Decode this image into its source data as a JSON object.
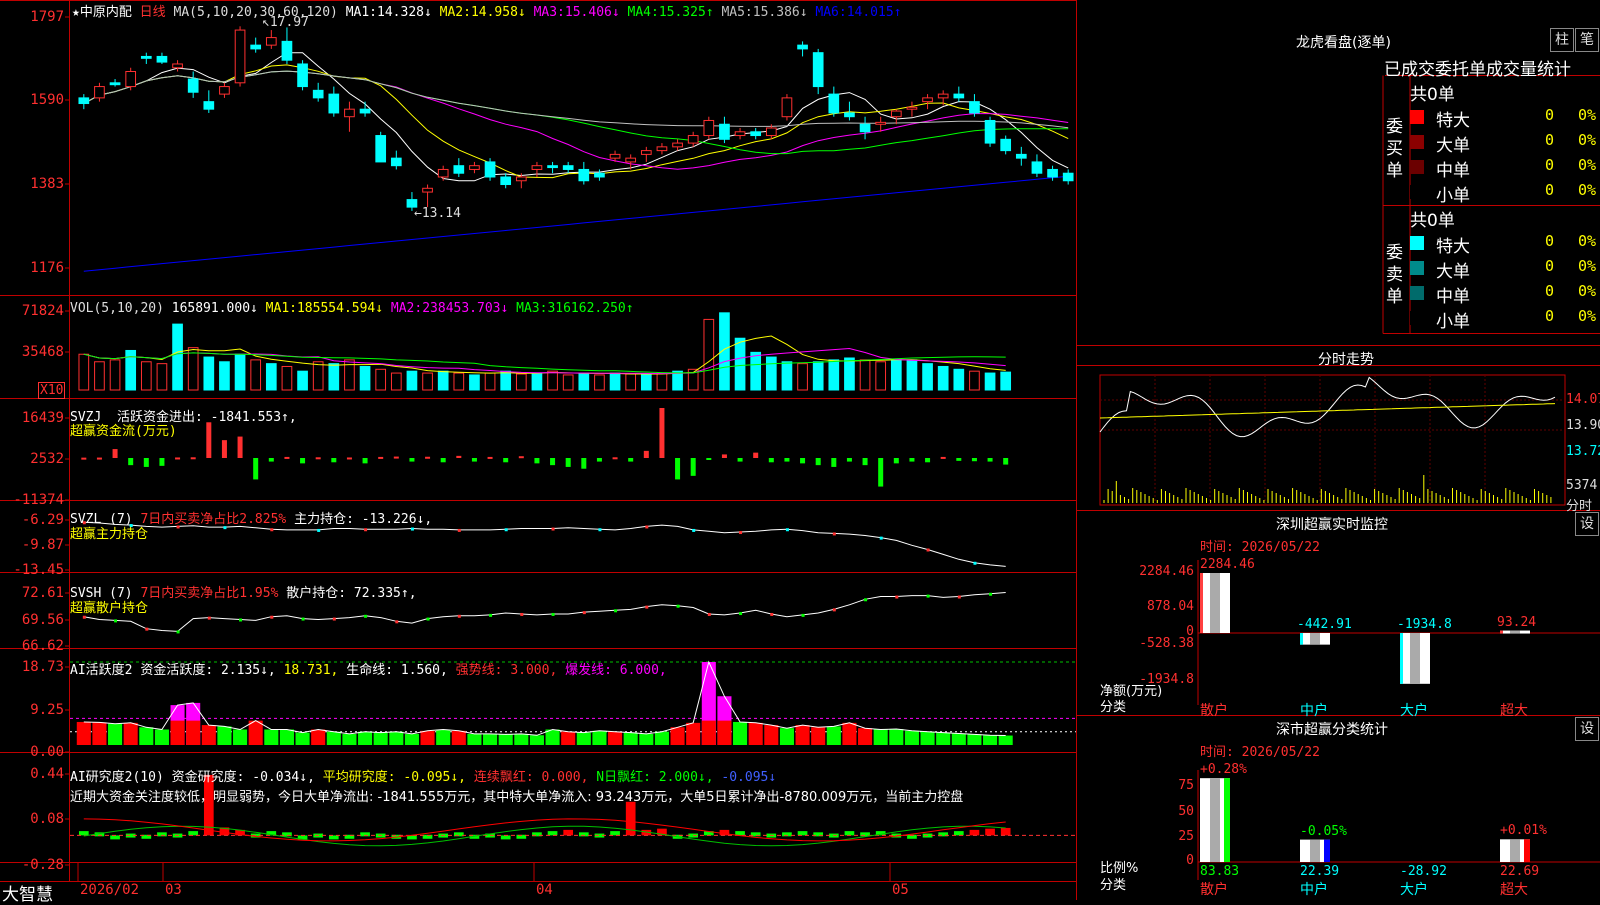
{
  "app": {
    "name": "大智慧",
    "star_title": "★中原内配",
    "period": "日线"
  },
  "main_legend": {
    "ma_label": "MA(5,10,20,30,60,120)",
    "items": [
      {
        "label": "MA1:",
        "value": "14.328↓",
        "color": "#ffffff"
      },
      {
        "label": "MA2:",
        "value": "14.958↓",
        "color": "#ffff00"
      },
      {
        "label": "MA3:",
        "value": "15.406↓",
        "color": "#ff00ff"
      },
      {
        "label": "MA4:",
        "value": "15.325↑",
        "color": "#00ff00"
      },
      {
        "label": "MA5:",
        "value": "15.386↓",
        "color": "#c0c0c0"
      },
      {
        "label": "MA6:",
        "value": "14.015↑",
        "color": "#0000ff"
      }
    ],
    "high_note": "17.97",
    "low_note": "13.14"
  },
  "vol_legend": {
    "label": "VOL(5,10,20)",
    "value": "165891.000↓",
    "items": [
      {
        "label": "MA1:",
        "value": "185554.594↓",
        "color": "#ffff00"
      },
      {
        "label": "MA2:",
        "value": "238453.703↓",
        "color": "#ff00ff"
      },
      {
        "label": "MA3:",
        "value": "316162.250↑",
        "color": "#00ff00"
      }
    ],
    "unit": "X10"
  },
  "svzj_legend": {
    "name": "SVZJ",
    "text": "活跃资金进出: -1841.553↑,",
    "sub": "超赢资金流(万元)"
  },
  "svzl_legend": {
    "name": "SVZL (7)",
    "text1": "7日内买卖净占比2.825%",
    "text2": "主力持仓: -13.226↓,",
    "sub": "超赢主力持仓"
  },
  "svsh_legend": {
    "name": "SVSH (7)",
    "text1": "7日内买卖净占比1.95%",
    "text2": "散户持仓: 72.335↑,",
    "sub": "超赢散户持仓"
  },
  "ai_legend": {
    "name": "AI活跃度2",
    "a": "资金活跃度: 2.135↓,",
    "b": "18.731,",
    "c": "生命线: 1.560,",
    "d": "强势线: 3.000,",
    "e": "爆发线: 6.000,"
  },
  "ai2_legend": {
    "name": "AI研究度2(10)",
    "a": "资金研究度: -0.034↓,",
    "b": "平均研究度: -0.095↓,",
    "c": "连续飘红: 0.000,",
    "d": "N日飘红: 2.000↓,",
    "e": "-0.095↓"
  },
  "commentary": "近期大资金关注度较低，明显弱势，今日大单净流出: -1841.555万元，其中特大单净流入: 93.243万元，大单5日累计净出-8780.009万元，当前主力控盘",
  "y_axes": {
    "main": [
      "1797",
      "1590",
      "1383",
      "1176"
    ],
    "vol": [
      "71824",
      "35468"
    ],
    "svzj": [
      "16439",
      "2532",
      "-11374"
    ],
    "svzl": [
      "-6.29",
      "-9.87",
      "-13.45"
    ],
    "svsh": [
      "72.61",
      "69.56",
      "66.62"
    ],
    "ai": [
      "18.73",
      "9.25",
      "0.00"
    ],
    "ai2": [
      "0.44",
      "0.08",
      "-0.28"
    ]
  },
  "x_axis": [
    "2026/02",
    "03",
    "04",
    "05"
  ],
  "right": {
    "longhu_title": "龙虎看盘(逐单)",
    "btn_bar": "柱",
    "btn_pen": "笔",
    "tabs_label": "已成交委托单成交量统计",
    "buy_side": "委买单",
    "sell_side": "委卖单",
    "buy_total": "共0单",
    "sell_total": "共0单",
    "buy_rows": [
      {
        "label": "特大",
        "count": "0",
        "pct": "0%",
        "color": "#ff0000"
      },
      {
        "label": "大单",
        "count": "0",
        "pct": "0%",
        "color": "#8b0000"
      },
      {
        "label": "中单",
        "count": "0",
        "pct": "0%",
        "color": "#6b0000"
      },
      {
        "label": "小单",
        "count": "0",
        "pct": "0%",
        "color": "#000000"
      }
    ],
    "sell_rows": [
      {
        "label": "特大",
        "count": "0",
        "pct": "0%",
        "color": "#00ffff"
      },
      {
        "label": "大单",
        "count": "0",
        "pct": "0%",
        "color": "#008b8b"
      },
      {
        "label": "中单",
        "count": "0",
        "pct": "0%",
        "color": "#006b6b"
      },
      {
        "label": "小单",
        "count": "0",
        "pct": "0%",
        "color": "#000000"
      }
    ],
    "intraday_title": "分时走势",
    "intraday_ticks": [
      "14.07",
      "13.90",
      "13.72",
      "5374",
      "分时"
    ],
    "sz_monitor_title": "深圳超赢实时监控",
    "sz_time": "时间: 2026/05/22",
    "sz_yticks": [
      "2284.46",
      "878.04",
      "0",
      "-528.38",
      "-1934.8"
    ],
    "sz_bars": [
      {
        "cat": "散户",
        "value": 2284.46,
        "label": "2284.46",
        "color": "#ff4040"
      },
      {
        "cat": "中户",
        "value": -442.91,
        "label": "-442.91",
        "color": "#00ffff"
      },
      {
        "cat": "大户",
        "value": -1934.8,
        "label": "-1934.8",
        "color": "#00ffff"
      },
      {
        "cat": "超大",
        "value": 93.24,
        "label": "93.24",
        "color": "#ff4040"
      }
    ],
    "sz_ylabel1": "净额(万元)",
    "sz_ylabel2": "分类",
    "cls_title": "深市超赢分类统计",
    "cls_time": "时间: 2026/05/22",
    "cls_yticks": [
      "75",
      "50",
      "25",
      "0"
    ],
    "cls_bars": [
      {
        "cat": "散户",
        "value": 83.83,
        "pct": "+0.28%",
        "label": "83.83",
        "color": "#00ff00"
      },
      {
        "cat": "中户",
        "value": 22.39,
        "pct": "-0.05%",
        "label": "22.39",
        "color": "#0000ff"
      },
      {
        "cat": "大户",
        "value": -28.92,
        "pct": "",
        "label": "-28.92",
        "color": "#00ffff"
      },
      {
        "cat": "超大",
        "value": 22.69,
        "pct": "+0.01%",
        "label": "22.69",
        "color": "#ff0000"
      }
    ],
    "cls_ylabel1": "比例%",
    "cls_ylabel2": "分类",
    "set_label": "设"
  },
  "chart_data": {
    "type": "candlestick",
    "note": "price values in 0.01 yuan (axis shows 1797 = 17.97)",
    "ylim": [
      1100,
      1830
    ],
    "candles": [
      [
        1610,
        1620,
        1580,
        1595
      ],
      [
        1610,
        1650,
        1600,
        1640
      ],
      [
        1650,
        1660,
        1640,
        1645
      ],
      [
        1640,
        1690,
        1630,
        1680
      ],
      [
        1720,
        1730,
        1700,
        1715
      ],
      [
        1720,
        1730,
        1700,
        1705
      ],
      [
        1690,
        1710,
        1680,
        1700
      ],
      [
        1660,
        1680,
        1610,
        1625
      ],
      [
        1600,
        1630,
        1570,
        1580
      ],
      [
        1620,
        1650,
        1610,
        1640
      ],
      [
        1650,
        1800,
        1640,
        1790
      ],
      [
        1750,
        1770,
        1730,
        1740
      ],
      [
        1750,
        1790,
        1740,
        1770
      ],
      [
        1760,
        1797,
        1700,
        1710
      ],
      [
        1700,
        1710,
        1630,
        1640
      ],
      [
        1630,
        1650,
        1600,
        1610
      ],
      [
        1620,
        1640,
        1560,
        1570
      ],
      [
        1560,
        1600,
        1520,
        1580
      ],
      [
        1580,
        1600,
        1560,
        1570
      ],
      [
        1510,
        1520,
        1440,
        1440
      ],
      [
        1450,
        1470,
        1420,
        1430
      ],
      [
        1340,
        1360,
        1310,
        1320
      ],
      [
        1360,
        1380,
        1320,
        1370
      ],
      [
        1400,
        1430,
        1390,
        1420
      ],
      [
        1430,
        1450,
        1400,
        1410
      ],
      [
        1420,
        1440,
        1410,
        1430
      ],
      [
        1440,
        1450,
        1390,
        1400
      ],
      [
        1400,
        1410,
        1370,
        1380
      ],
      [
        1390,
        1410,
        1370,
        1400
      ],
      [
        1420,
        1440,
        1400,
        1430
      ],
      [
        1430,
        1440,
        1410,
        1425
      ],
      [
        1430,
        1440,
        1410,
        1420
      ],
      [
        1420,
        1440,
        1380,
        1390
      ],
      [
        1410,
        1420,
        1390,
        1400
      ],
      [
        1450,
        1470,
        1440,
        1460
      ],
      [
        1440,
        1460,
        1420,
        1450
      ],
      [
        1460,
        1480,
        1440,
        1470
      ],
      [
        1470,
        1490,
        1460,
        1480
      ],
      [
        1480,
        1500,
        1470,
        1490
      ],
      [
        1490,
        1520,
        1480,
        1510
      ],
      [
        1510,
        1560,
        1500,
        1550
      ],
      [
        1540,
        1560,
        1490,
        1500
      ],
      [
        1510,
        1530,
        1500,
        1520
      ],
      [
        1520,
        1530,
        1500,
        1510
      ],
      [
        1510,
        1540,
        1500,
        1530
      ],
      [
        1560,
        1620,
        1550,
        1610
      ],
      [
        1750,
        1760,
        1720,
        1740
      ],
      [
        1730,
        1740,
        1620,
        1640
      ],
      [
        1620,
        1640,
        1560,
        1570
      ],
      [
        1570,
        1600,
        1550,
        1560
      ],
      [
        1540,
        1560,
        1500,
        1520
      ],
      [
        1540,
        1560,
        1520,
        1545
      ],
      [
        1560,
        1580,
        1540,
        1575
      ],
      [
        1580,
        1600,
        1560,
        1585
      ],
      [
        1600,
        1620,
        1580,
        1610
      ],
      [
        1610,
        1630,
        1590,
        1620
      ],
      [
        1620,
        1640,
        1600,
        1610
      ],
      [
        1600,
        1620,
        1560,
        1570
      ],
      [
        1550,
        1560,
        1480,
        1490
      ],
      [
        1500,
        1510,
        1460,
        1470
      ],
      [
        1460,
        1480,
        1430,
        1450
      ],
      [
        1440,
        1460,
        1400,
        1410
      ],
      [
        1420,
        1430,
        1390,
        1400
      ],
      [
        1410,
        1420,
        1380,
        1390
      ]
    ],
    "volume": [
      [
        38000,
        1
      ],
      [
        30000,
        1
      ],
      [
        32000,
        1
      ],
      [
        42000,
        0
      ],
      [
        30000,
        1
      ],
      [
        28000,
        1
      ],
      [
        70000,
        0
      ],
      [
        45000,
        1
      ],
      [
        35000,
        0
      ],
      [
        30000,
        0
      ],
      [
        38000,
        0
      ],
      [
        32000,
        1
      ],
      [
        28000,
        0
      ],
      [
        25000,
        1
      ],
      [
        20000,
        0
      ],
      [
        30000,
        1
      ],
      [
        28000,
        0
      ],
      [
        32000,
        1
      ],
      [
        25000,
        0
      ],
      [
        22000,
        1
      ],
      [
        18000,
        1
      ],
      [
        20000,
        0
      ],
      [
        18000,
        1
      ],
      [
        20000,
        0
      ],
      [
        18000,
        1
      ],
      [
        16000,
        0
      ],
      [
        18000,
        1
      ],
      [
        20000,
        0
      ],
      [
        17000,
        1
      ],
      [
        18000,
        0
      ],
      [
        20000,
        1
      ],
      [
        16000,
        1
      ],
      [
        18000,
        0
      ],
      [
        16000,
        1
      ],
      [
        18000,
        0
      ],
      [
        17000,
        1
      ],
      [
        16000,
        0
      ],
      [
        18000,
        1
      ],
      [
        20000,
        0
      ],
      [
        22000,
        1
      ],
      [
        75000,
        1
      ],
      [
        82000,
        0
      ],
      [
        55000,
        0
      ],
      [
        40000,
        0
      ],
      [
        35000,
        0
      ],
      [
        30000,
        0
      ],
      [
        28000,
        1
      ],
      [
        30000,
        0
      ],
      [
        32000,
        0
      ],
      [
        34000,
        0
      ],
      [
        32000,
        1
      ],
      [
        30000,
        1
      ],
      [
        33000,
        0
      ],
      [
        32000,
        0
      ],
      [
        28000,
        0
      ],
      [
        25000,
        0
      ],
      [
        22000,
        0
      ],
      [
        20000,
        1
      ],
      [
        18000,
        0
      ],
      [
        19000,
        0
      ]
    ],
    "svzj": [
      100,
      120,
      2500,
      -2000,
      -2500,
      -2200,
      150,
      200,
      10000,
      5000,
      6000,
      -6000,
      -1000,
      300,
      -1500,
      200,
      -1200,
      150,
      -1500,
      300,
      400,
      -1000,
      350,
      -1200,
      600,
      -1000,
      300,
      -1200,
      500,
      -1500,
      -2000,
      -2500,
      -3000,
      -1000,
      200,
      -1000,
      2000,
      14000,
      -6000,
      -5000,
      -500,
      1000,
      -1000,
      1500,
      -1200,
      -1000,
      -1500,
      -2000,
      -2500,
      -1000,
      -2000,
      -8000,
      -1500,
      -1000,
      -1200,
      300,
      -800,
      -900,
      -1000,
      -1841
    ],
    "svzl": [
      -6.9,
      -7.0,
      -7.2,
      -7.3,
      -7.5,
      -7.6,
      -7.5,
      -7.4,
      -7.6,
      -7.6,
      -7.5,
      -7.7,
      -7.9,
      -8.0,
      -8.0,
      -8.0,
      -7.8,
      -7.8,
      -7.9,
      -7.9,
      -7.9,
      -7.8,
      -7.9,
      -7.9,
      -8.0,
      -8.0,
      -8.0,
      -7.9,
      -7.8,
      -7.8,
      -7.8,
      -7.7,
      -7.8,
      -7.9,
      -8.0,
      -7.8,
      -7.5,
      -7.3,
      -7.5,
      -8.0,
      -8.2,
      -8.4,
      -8.3,
      -8.2,
      -8.0,
      -7.9,
      -8.1,
      -8.4,
      -8.5,
      -8.6,
      -8.8,
      -9.1,
      -9.5,
      -10.2,
      -10.8,
      -11.5,
      -12.2,
      -12.7,
      -13.0,
      -13.226
    ],
    "svsh": [
      69.7,
      69.4,
      69.3,
      69.2,
      68.4,
      68.2,
      68.1,
      69.5,
      69.6,
      69.5,
      69.4,
      69.3,
      69.7,
      69.8,
      69.5,
      69.4,
      69.5,
      69.6,
      69.8,
      69.6,
      69.2,
      69.0,
      69.5,
      69.7,
      69.8,
      69.8,
      69.9,
      70.1,
      70.0,
      69.9,
      70.0,
      70.0,
      70.2,
      70.3,
      70.4,
      70.5,
      70.8,
      71.0,
      70.9,
      70.7,
      70.0,
      69.9,
      70.1,
      70.4,
      70.0,
      69.7,
      69.9,
      70.1,
      70.5,
      71.0,
      71.6,
      71.9,
      71.9,
      72.0,
      72.0,
      71.8,
      71.9,
      72.1,
      72.2,
      72.335
    ],
    "ai": [
      [
        5.2,
        0
      ],
      [
        5.1,
        0
      ],
      [
        4.8,
        1
      ],
      [
        5.0,
        0
      ],
      [
        4.0,
        1
      ],
      [
        3.5,
        1
      ],
      [
        9.0,
        2
      ],
      [
        9.5,
        2
      ],
      [
        4.5,
        0
      ],
      [
        4.2,
        1
      ],
      [
        3.5,
        1
      ],
      [
        5.5,
        0
      ],
      [
        3.5,
        1
      ],
      [
        3.5,
        1
      ],
      [
        2.8,
        1
      ],
      [
        3.5,
        0
      ],
      [
        3.0,
        1
      ],
      [
        2.5,
        1
      ],
      [
        3.0,
        1
      ],
      [
        2.8,
        1
      ],
      [
        3.0,
        1
      ],
      [
        2.5,
        1
      ],
      [
        3.2,
        0
      ],
      [
        3.5,
        1
      ],
      [
        3.2,
        0
      ],
      [
        2.5,
        1
      ],
      [
        2.5,
        1
      ],
      [
        2.4,
        1
      ],
      [
        2.5,
        1
      ],
      [
        2.2,
        1
      ],
      [
        3.5,
        1
      ],
      [
        3.0,
        0
      ],
      [
        2.8,
        1
      ],
      [
        3.2,
        1
      ],
      [
        3.0,
        0
      ],
      [
        2.8,
        1
      ],
      [
        2.5,
        1
      ],
      [
        3.0,
        1
      ],
      [
        4.0,
        0
      ],
      [
        5.0,
        0
      ],
      [
        18.73,
        2
      ],
      [
        11.0,
        2
      ],
      [
        5.2,
        1
      ],
      [
        5.0,
        0
      ],
      [
        4.5,
        0
      ],
      [
        3.8,
        1
      ],
      [
        4.5,
        0
      ],
      [
        4.0,
        0
      ],
      [
        4.2,
        1
      ],
      [
        5.0,
        0
      ],
      [
        3.8,
        0
      ],
      [
        3.5,
        1
      ],
      [
        3.6,
        1
      ],
      [
        3.2,
        1
      ],
      [
        3.0,
        1
      ],
      [
        2.8,
        1
      ],
      [
        2.6,
        1
      ],
      [
        2.4,
        1
      ],
      [
        2.2,
        1
      ],
      [
        2.135,
        1
      ]
    ],
    "ai2": [
      -0.06,
      -0.07,
      -0.1,
      -0.08,
      -0.09,
      -0.07,
      -0.08,
      -0.06,
      0.4,
      -0.03,
      -0.05,
      -0.08,
      -0.06,
      -0.07,
      -0.1,
      -0.08,
      -0.1,
      -0.09,
      -0.07,
      -0.08,
      -0.09,
      -0.1,
      -0.09,
      -0.08,
      -0.07,
      -0.09,
      -0.08,
      -0.1,
      -0.09,
      -0.07,
      -0.06,
      -0.05,
      -0.07,
      -0.08,
      -0.06,
      0.18,
      -0.05,
      -0.04,
      -0.09,
      -0.08,
      -0.06,
      -0.05,
      -0.06,
      -0.07,
      -0.08,
      -0.07,
      -0.06,
      -0.07,
      -0.08,
      -0.06,
      -0.07,
      -0.06,
      -0.08,
      -0.09,
      -0.08,
      -0.07,
      -0.06,
      -0.05,
      -0.04,
      -0.034
    ]
  }
}
